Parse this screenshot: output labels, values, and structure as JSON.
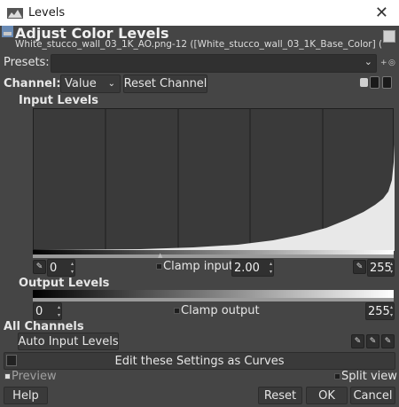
{
  "window": {
    "title": "Levels",
    "close_glyph": "✕"
  },
  "header": {
    "title": "Adjust Color Levels",
    "subtitle": "White_stucco_wall_03_1K_AO.png-12 ([White_stucco_wall_03_1K_Base_Color] (i..."
  },
  "presets": {
    "label": "Presets:",
    "value": "",
    "add_glyph": "+",
    "manage_glyph": "◎"
  },
  "channel": {
    "label": "Channel:",
    "value": "Value",
    "reset_label": "Reset Channel"
  },
  "input_levels": {
    "label": "Input Levels",
    "low": "0",
    "gamma": "2.00",
    "high": "255",
    "clamp_label": "Clamp input"
  },
  "output_levels": {
    "label": "Output Levels",
    "low": "0",
    "high": "255",
    "clamp_label": "Clamp output"
  },
  "all_channels": {
    "label": "All Channels",
    "auto_label": "Auto Input Levels"
  },
  "curves_button": {
    "label": "Edit these Settings as Curves"
  },
  "preview": {
    "label": "Preview",
    "split_label": "Split view"
  },
  "buttons": {
    "help": "Help",
    "reset": "Reset",
    "ok": "OK",
    "cancel": "Cancel"
  },
  "colors": {
    "background": "#454545",
    "histogram_bg": "#3a3a3a",
    "histogram_fill": "#e8e8e8",
    "titlebar": "#ffffff"
  },
  "icons": [
    "levels-icon",
    "close-icon",
    "image-thumbnail-icon",
    "chevron-down-icon",
    "eyedropper-black-icon",
    "eyedropper-gray-icon",
    "eyedropper-white-icon",
    "curves-icon"
  ]
}
